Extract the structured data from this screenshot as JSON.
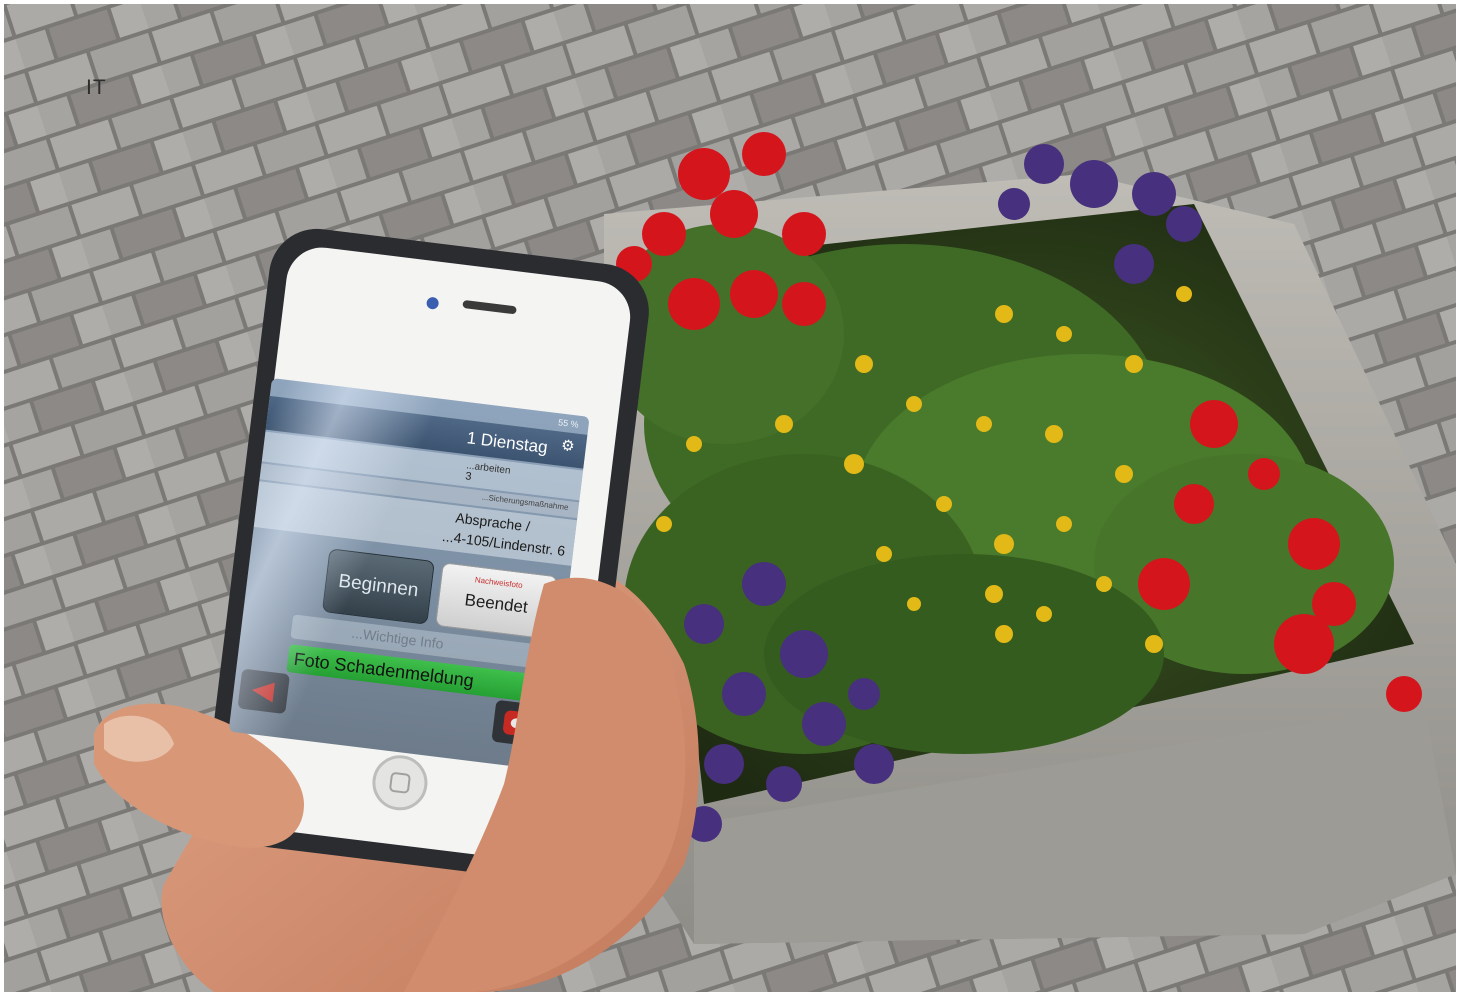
{
  "page": {
    "corner_label": "IT"
  },
  "phone_app": {
    "status": "55 %",
    "day_label": "1  Dienstag",
    "row_top_text": "...arbeiten",
    "row_top_sub": "3",
    "row_small_text": "...Sicherungsmaßnahme",
    "address_line1": "Absprache /",
    "address_line2": "...4-105/Lindenstr. 6",
    "begin_button": "Beginnen",
    "end_button_small": "Nachweisfoto",
    "end_button": "Beendet",
    "faint_row_text": "...Wichtige Info",
    "photo_button": "Foto Schadenmeldung",
    "icons": {
      "settings": "gear-icon",
      "back": "back-arrow-icon",
      "call": "phone-icon"
    }
  },
  "colors": {
    "pavement": "#a7a6a2",
    "planter": "#a9a7a0",
    "phone_case": "#2b2c30",
    "app_header": "#4a6482",
    "photo_button": "#2fae3d",
    "flower_red": "#d4161c",
    "flower_purple": "#47307d",
    "flower_yellow": "#e2b917"
  }
}
